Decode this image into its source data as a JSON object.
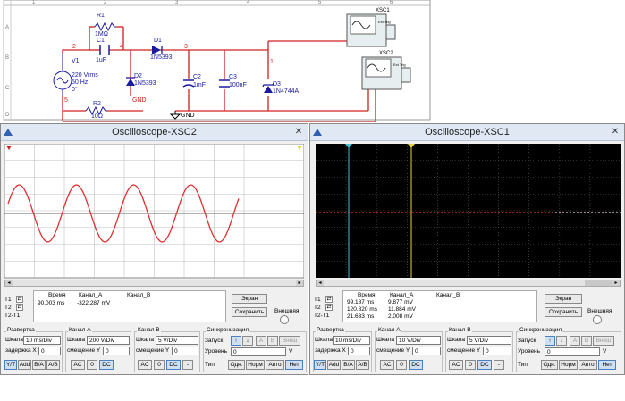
{
  "schematic": {
    "ruler_numbers": [
      "1",
      "2",
      "3",
      "4",
      "5",
      "6"
    ],
    "ruler_letters": [
      "A",
      "B",
      "C",
      "D"
    ],
    "r1": {
      "ref": "R1",
      "value": "1MΩ"
    },
    "c1": {
      "ref": "C1",
      "value": "1uF"
    },
    "d1": {
      "ref": "D1",
      "value": "1N5393"
    },
    "d2": {
      "ref": "D2",
      "value": "1N5393"
    },
    "c2": {
      "ref": "C2",
      "value": "1mF"
    },
    "c3": {
      "ref": "C3",
      "value": "100nF"
    },
    "d3": {
      "ref": "D3",
      "value": "1N4744A"
    },
    "v1": {
      "ref": "V1",
      "l1": "220 Vrms",
      "l2": "50 Hz",
      "l3": "0°"
    },
    "r2": {
      "ref": "R2",
      "value": "10Ω"
    },
    "gnd1": "GND",
    "gnd2": "GND",
    "nodes": {
      "n2": "2",
      "n4": "4",
      "n3": "3",
      "n1": "1",
      "n5": "5"
    },
    "xsc1": "XSC1",
    "xsc2": "XSC2",
    "ext_trig": "Ext Trig"
  },
  "scope2": {
    "title": "Oscilloscope-XSC2",
    "t1": "T1",
    "t2": "T2",
    "t2t1": "T2-T1",
    "col_time": "Время",
    "col_a": "Канал_A",
    "col_b": "Канал_B",
    "row1_time": "90.003 ms",
    "row1_a": "-322.287 mV",
    "btn_screen": "Экран",
    "btn_save": "Сохранить",
    "ext": "Внешняя",
    "sweep": {
      "title": "Развертка",
      "scale_lbl": "Шкала",
      "scale": "10 ms/Div",
      "delay_lbl": "задержка X",
      "delay": "0",
      "yt": "Y/T",
      "add": "Add",
      "ba": "B/A",
      "ab": "A/B"
    },
    "cha": {
      "title": "Канал А",
      "scale_lbl": "Шкала",
      "scale": "200  V/Div",
      "off_lbl": "смещение Y",
      "off": "0",
      "ac": "AC",
      "zero": "0",
      "dc": "DC"
    },
    "chb": {
      "title": "Канал В",
      "scale_lbl": "Шкала",
      "scale": "5  V/Div",
      "off_lbl": "смещение Y",
      "off": "0",
      "ac": "AC",
      "zero": "0",
      "dc": "DC",
      "minus": "-"
    },
    "sync": {
      "title": "Синхронизация",
      "start": "Запуск",
      "level": "Уровень",
      "level_val": "0",
      "unit": "V",
      "type": "Тип",
      "single": "Одн.",
      "norm": "Норм",
      "auto": "Авто",
      "none": "Нет",
      "ext_btn": "Внеш",
      "a": "A",
      "b": "B"
    }
  },
  "scope1": {
    "title": "Oscilloscope-XSC1",
    "t1": "T1",
    "t2": "T2",
    "t2t1": "T2-T1",
    "col_time": "Время",
    "col_a": "Канал_A",
    "col_b": "Канал_B",
    "row1_time": "99.187 ms",
    "row1_a": "9.877 mV",
    "row2_time": "120.820 ms",
    "row2_a": "11.884 mV",
    "row3_time": "21.633 ms",
    "row3_a": "2.008 mV",
    "btn_screen": "Экран",
    "btn_save": "Сохранить",
    "ext": "Внешняя",
    "sweep": {
      "title": "Развертка",
      "scale_lbl": "Шкала",
      "scale": "10 ms/Div",
      "delay_lbl": "задержка X",
      "delay": "0",
      "yt": "Y/T",
      "add": "Add",
      "ba": "B/A",
      "ab": "A/B"
    },
    "cha": {
      "title": "Канал А",
      "scale_lbl": "Шкала",
      "scale": "10  V/Div",
      "off_lbl": "смещение Y",
      "off": "0",
      "ac": "AC",
      "zero": "0",
      "dc": "DC"
    },
    "chb": {
      "title": "Канал В",
      "scale_lbl": "Шкала",
      "scale": "5  V/Div",
      "off_lbl": "смещение Y",
      "off": "0",
      "ac": "AC",
      "zero": "0",
      "dc": "DC",
      "minus": "-"
    },
    "sync": {
      "title": "Синхронизация",
      "start": "Запуск",
      "level": "Уровень",
      "level_val": "0",
      "unit": "V",
      "type": "Тип",
      "single": "Одн.",
      "norm": "Норм",
      "auto": "Авто",
      "none": "Нет",
      "ext_btn": "Внеш",
      "a": "A",
      "b": "B"
    }
  },
  "colors": {
    "trace_a": "#e03030",
    "wire": "#d02020",
    "component": "#1a1aa0",
    "screen2_bg": "#ffffff",
    "screen1_bg": "#000000",
    "cursor1": "#40c0d0",
    "cursor2": "#e8d040"
  }
}
